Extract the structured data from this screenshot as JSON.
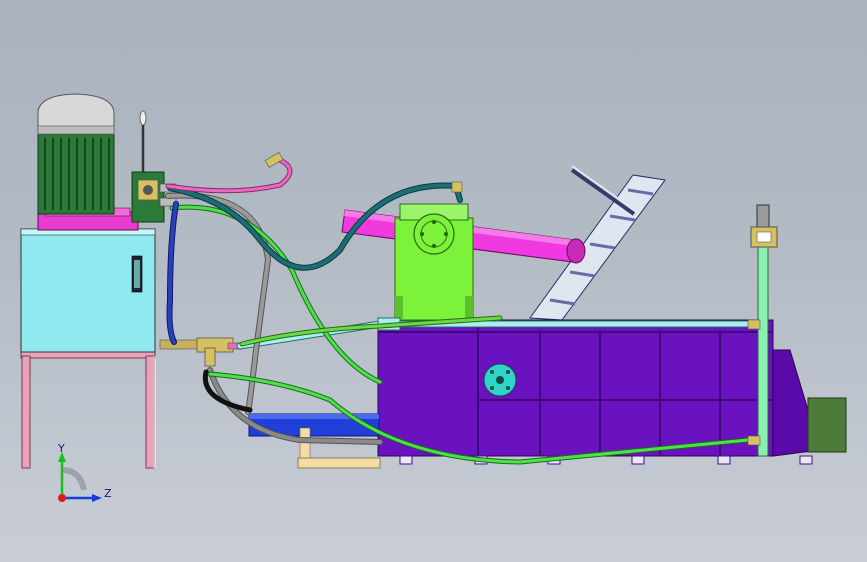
{
  "axes": {
    "y_label": "Y",
    "z_label": "Z"
  },
  "colors": {
    "background_top": "#a9b2bd",
    "background_bottom": "#c9ced6",
    "tank": "#8fe9ee",
    "tank_stand": "#e8a3b7",
    "motor": "#2c7a3a",
    "motor_cap": "#d8d8d8",
    "flange": "#e83cd0",
    "press_body": "#6a11c0",
    "press_frame": "#4a0a8a",
    "cylinder": "#f03ae0",
    "upright": "#7cf23a",
    "blue_ram": "#1f3fd8",
    "base_plate": "#f3dca6",
    "hose_green": "#4ee04a",
    "hose_teal": "#1c6e76",
    "hose_gray": "#8a8a8a",
    "hose_pink": "#e86ac0",
    "hose_blue": "#2a3fb8",
    "pipe_cyan": "#a8f0f0",
    "rail": "#8af0b0",
    "dark_green_box": "#4e7a3a",
    "port_cyan": "#2fd3c8"
  }
}
